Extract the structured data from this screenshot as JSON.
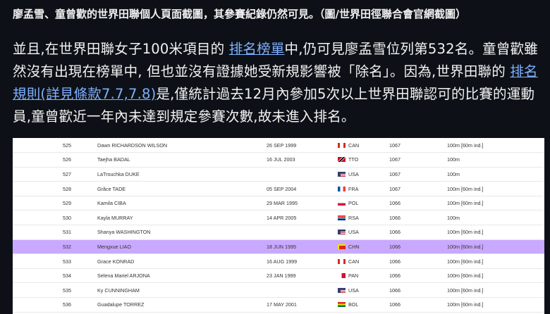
{
  "caption": "廖孟雪、童曾歡的世界田聯個人頁面截圖，其參賽紀錄仍然可見。（圖/世界田徑聯合會官網截圖）",
  "paragraph": {
    "p1": "並且,在世界田聯女子100米項目的 ",
    "link1": "排名榜單",
    "p2": "中,仍可見廖孟雪位列第532名。童曾歡雖然沒有出現在榜單中, 但也並沒有證據她受新規影響被「除名」。因為,世界田聯的 ",
    "link2": "排名規則(詳見條款7.7,7.8)",
    "p3": "是,僅統計過去12月內參加5次以上世界田聯認可的比賽的運動員,童曾歡近一年內未達到規定參賽次數,故未進入排名。"
  },
  "colors": {
    "highlight_row": "#c9a9ff",
    "link": "#7fb0ff",
    "page_bg": "#0d1117"
  },
  "ranking": [
    {
      "rank": "525",
      "name": "Dawn RICHARDSON WILSON",
      "dob": "26 SEP 1999",
      "flag": "CAN",
      "nat": "CAN",
      "score": "1067",
      "event": "100m [60m ind.]"
    },
    {
      "rank": "526",
      "name": "Taejha BADAL",
      "dob": "16 JUL 2003",
      "flag": "TTO",
      "nat": "TTO",
      "score": "1067",
      "event": "100m"
    },
    {
      "rank": "527",
      "name": "LaTrouchka DUKE",
      "dob": "",
      "flag": "USA",
      "nat": "USA",
      "score": "1067",
      "event": "100m"
    },
    {
      "rank": "528",
      "name": "Grâce TADE",
      "dob": "05 SEP 2004",
      "flag": "FRA",
      "nat": "FRA",
      "score": "1067",
      "event": "100m [60m ind.]"
    },
    {
      "rank": "529",
      "name": "Kamila CIBA",
      "dob": "29 MAR 1995",
      "flag": "POL",
      "nat": "POL",
      "score": "1066",
      "event": "100m [60m ind.]"
    },
    {
      "rank": "530",
      "name": "Kayla MURRAY",
      "dob": "14 APR 2005",
      "flag": "RSA",
      "nat": "RSA",
      "score": "1066",
      "event": "100m"
    },
    {
      "rank": "531",
      "name": "Shanya WASHINGTON",
      "dob": "",
      "flag": "USA",
      "nat": "USA",
      "score": "1066",
      "event": "100m [60m ind.]"
    },
    {
      "rank": "532",
      "name": "Mengxue LIAO",
      "dob": "18 JUN 1995",
      "flag": "CHN",
      "nat": "CHN",
      "score": "1066",
      "event": "100m [60m ind.]",
      "highlight": true
    },
    {
      "rank": "533",
      "name": "Grace KONRAD",
      "dob": "16 AUG 1999",
      "flag": "CAN",
      "nat": "CAN",
      "score": "1066",
      "event": "100m [60m ind.]"
    },
    {
      "rank": "534",
      "name": "Selena Mariel ARJONA",
      "dob": "23 JAN 1999",
      "flag": "PAN",
      "nat": "PAN",
      "score": "1066",
      "event": "100m [60m ind.]"
    },
    {
      "rank": "535",
      "name": "Ky CUNNINGHAM",
      "dob": "",
      "flag": "USA",
      "nat": "USA",
      "score": "1066",
      "event": "100m [60m ind.]"
    },
    {
      "rank": "536",
      "name": "Guadalupe TORREZ",
      "dob": "17 MAY 2001",
      "flag": "BOL",
      "nat": "BOL",
      "score": "1066",
      "event": "100m [60m ind.]"
    }
  ]
}
